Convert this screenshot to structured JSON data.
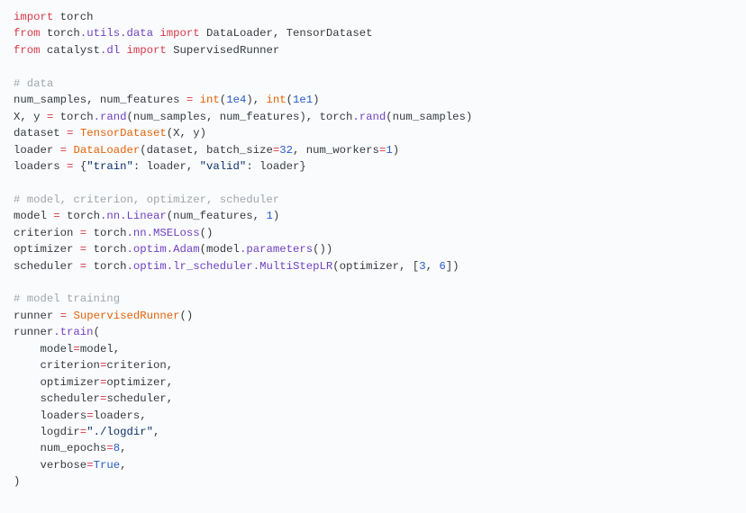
{
  "code": {
    "lines": [
      [
        [
          "kw",
          "import"
        ],
        [
          "var",
          " torch"
        ]
      ],
      [
        [
          "kw",
          "from"
        ],
        [
          "var",
          " torch"
        ],
        [
          "attr",
          ".utils"
        ],
        [
          "attr",
          ".data"
        ],
        [
          "var",
          " "
        ],
        [
          "kw",
          "import"
        ],
        [
          "var",
          " DataLoader, TensorDataset"
        ]
      ],
      [
        [
          "kw",
          "from"
        ],
        [
          "var",
          " catalyst"
        ],
        [
          "attr",
          ".dl"
        ],
        [
          "var",
          " "
        ],
        [
          "kw",
          "import"
        ],
        [
          "var",
          " SupervisedRunner"
        ]
      ],
      [
        [
          "var",
          ""
        ]
      ],
      [
        [
          "cmt",
          "# data"
        ]
      ],
      [
        [
          "var",
          "num_samples, num_features "
        ],
        [
          "op",
          "="
        ],
        [
          "var",
          " "
        ],
        [
          "call",
          "int"
        ],
        [
          "var",
          "("
        ],
        [
          "num",
          "1e4"
        ],
        [
          "var",
          "), "
        ],
        [
          "call",
          "int"
        ],
        [
          "var",
          "("
        ],
        [
          "num",
          "1e1"
        ],
        [
          "var",
          ")"
        ]
      ],
      [
        [
          "var",
          "X, y "
        ],
        [
          "op",
          "="
        ],
        [
          "var",
          " torch"
        ],
        [
          "attr",
          ".rand"
        ],
        [
          "var",
          "(num_samples, num_features), torch"
        ],
        [
          "attr",
          ".rand"
        ],
        [
          "var",
          "(num_samples)"
        ]
      ],
      [
        [
          "var",
          "dataset "
        ],
        [
          "op",
          "="
        ],
        [
          "var",
          " "
        ],
        [
          "call",
          "TensorDataset"
        ],
        [
          "var",
          "(X, y)"
        ]
      ],
      [
        [
          "var",
          "loader "
        ],
        [
          "op",
          "="
        ],
        [
          "var",
          " "
        ],
        [
          "call",
          "DataLoader"
        ],
        [
          "var",
          "(dataset, "
        ],
        [
          "var",
          "batch_size"
        ],
        [
          "op",
          "="
        ],
        [
          "num",
          "32"
        ],
        [
          "var",
          ", "
        ],
        [
          "var",
          "num_workers"
        ],
        [
          "op",
          "="
        ],
        [
          "num",
          "1"
        ],
        [
          "var",
          ")"
        ]
      ],
      [
        [
          "var",
          "loaders "
        ],
        [
          "op",
          "="
        ],
        [
          "var",
          " {"
        ],
        [
          "str",
          "\"train\""
        ],
        [
          "var",
          ": loader, "
        ],
        [
          "str",
          "\"valid\""
        ],
        [
          "var",
          ": loader}"
        ]
      ],
      [
        [
          "var",
          ""
        ]
      ],
      [
        [
          "cmt",
          "# model, criterion, optimizer, scheduler"
        ]
      ],
      [
        [
          "var",
          "model "
        ],
        [
          "op",
          "="
        ],
        [
          "var",
          " torch"
        ],
        [
          "attr",
          ".nn"
        ],
        [
          "attr",
          ".Linear"
        ],
        [
          "var",
          "(num_features, "
        ],
        [
          "num",
          "1"
        ],
        [
          "var",
          ")"
        ]
      ],
      [
        [
          "var",
          "criterion "
        ],
        [
          "op",
          "="
        ],
        [
          "var",
          " torch"
        ],
        [
          "attr",
          ".nn"
        ],
        [
          "attr",
          ".MSELoss"
        ],
        [
          "var",
          "()"
        ]
      ],
      [
        [
          "var",
          "optimizer "
        ],
        [
          "op",
          "="
        ],
        [
          "var",
          " torch"
        ],
        [
          "attr",
          ".optim"
        ],
        [
          "attr",
          ".Adam"
        ],
        [
          "var",
          "(model"
        ],
        [
          "attr",
          ".parameters"
        ],
        [
          "var",
          "())"
        ]
      ],
      [
        [
          "var",
          "scheduler "
        ],
        [
          "op",
          "="
        ],
        [
          "var",
          " torch"
        ],
        [
          "attr",
          ".optim"
        ],
        [
          "attr",
          ".lr_scheduler"
        ],
        [
          "attr",
          ".MultiStepLR"
        ],
        [
          "var",
          "(optimizer, ["
        ],
        [
          "num",
          "3"
        ],
        [
          "var",
          ", "
        ],
        [
          "num",
          "6"
        ],
        [
          "var",
          "])"
        ]
      ],
      [
        [
          "var",
          ""
        ]
      ],
      [
        [
          "cmt",
          "# model training"
        ]
      ],
      [
        [
          "var",
          "runner "
        ],
        [
          "op",
          "="
        ],
        [
          "var",
          " "
        ],
        [
          "call",
          "SupervisedRunner"
        ],
        [
          "var",
          "()"
        ]
      ],
      [
        [
          "var",
          "runner"
        ],
        [
          "attr",
          ".train"
        ],
        [
          "var",
          "("
        ]
      ],
      [
        [
          "var",
          "    model"
        ],
        [
          "op",
          "="
        ],
        [
          "var",
          "model,"
        ]
      ],
      [
        [
          "var",
          "    criterion"
        ],
        [
          "op",
          "="
        ],
        [
          "var",
          "criterion,"
        ]
      ],
      [
        [
          "var",
          "    optimizer"
        ],
        [
          "op",
          "="
        ],
        [
          "var",
          "optimizer,"
        ]
      ],
      [
        [
          "var",
          "    scheduler"
        ],
        [
          "op",
          "="
        ],
        [
          "var",
          "scheduler,"
        ]
      ],
      [
        [
          "var",
          "    loaders"
        ],
        [
          "op",
          "="
        ],
        [
          "var",
          "loaders,"
        ]
      ],
      [
        [
          "var",
          "    logdir"
        ],
        [
          "op",
          "="
        ],
        [
          "str",
          "\"./logdir\""
        ],
        [
          "var",
          ","
        ]
      ],
      [
        [
          "var",
          "    num_epochs"
        ],
        [
          "op",
          "="
        ],
        [
          "num",
          "8"
        ],
        [
          "var",
          ","
        ]
      ],
      [
        [
          "var",
          "    verbose"
        ],
        [
          "op",
          "="
        ],
        [
          "num",
          "True"
        ],
        [
          "var",
          ","
        ]
      ],
      [
        [
          "var",
          ")"
        ]
      ]
    ]
  }
}
